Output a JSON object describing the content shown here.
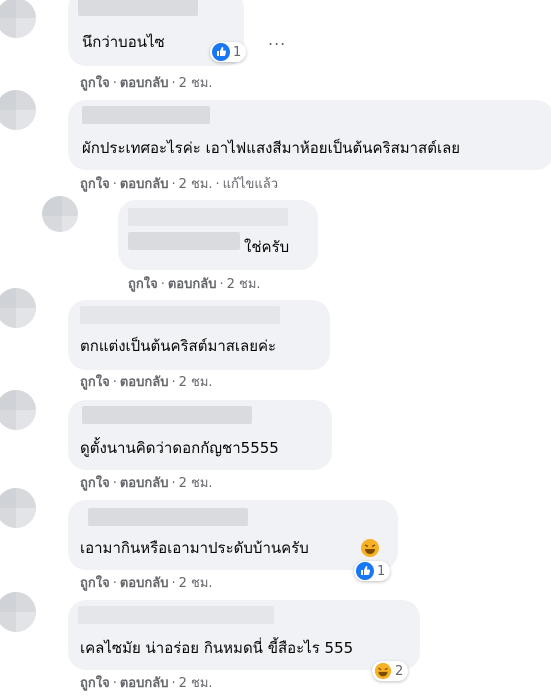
{
  "comments": [
    {
      "text": "นึกว่าบอนไซ",
      "actions": {
        "like": "ถูกใจ",
        "reply": "ตอบกลับ",
        "time": "2 ชม."
      },
      "reaction": {
        "type": "like",
        "count": "1"
      }
    },
    {
      "text": "ผักประเทศอะไรค่ะ เอาไฟแสงสีมาห้อยเป็นต้นคริสมาสต์เลย",
      "actions": {
        "like": "ถูกใจ",
        "reply": "ตอบกลับ",
        "time": "2 ชม.",
        "edited": "แก้ไขแล้ว"
      }
    },
    {
      "text": "ใช่ครับ",
      "actions": {
        "like": "ถูกใจ",
        "reply": "ตอบกลับ",
        "time": "2 ชม."
      }
    },
    {
      "text": "ตกแต่งเป็นต้นคริสต์มาสเลยค่ะ",
      "actions": {
        "like": "ถูกใจ",
        "reply": "ตอบกลับ",
        "time": "2 ชม."
      }
    },
    {
      "text": "ดูตั้งนานคิดว่าดอกกัญชา5555",
      "actions": {
        "like": "ถูกใจ",
        "reply": "ตอบกลับ",
        "time": "2 ชม."
      }
    },
    {
      "text": "เอามากินหรือเอามาประดับบ้านครับ",
      "actions": {
        "like": "ถูกใจ",
        "reply": "ตอบกลับ",
        "time": "2 ชม."
      },
      "reaction": {
        "type": "like",
        "count": "1"
      }
    },
    {
      "text": "เคลไซมัย น่าอร่อย กินหมดนี่ ขี้สือะไร 555",
      "actions": {
        "like": "ถูกใจ",
        "reply": "ตอบกลับ",
        "time": "2 ชม."
      },
      "reaction": {
        "type": "haha",
        "count": "2"
      }
    }
  ],
  "more_menu": "...",
  "colors": {
    "bubble": "#f0f2f5",
    "meta": "#65676b",
    "like_blue": "#1877f2",
    "haha_yellow": "#f7b125"
  }
}
